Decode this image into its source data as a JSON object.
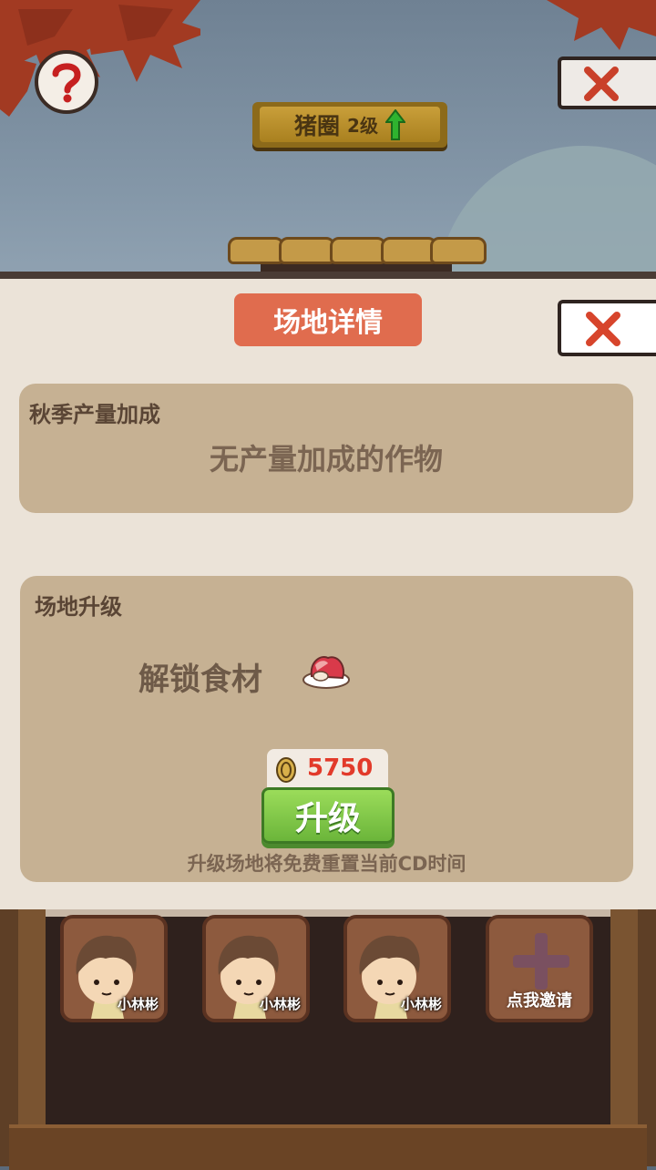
{
  "header": {
    "building_name": "猪圈",
    "level": "2级",
    "help_icon": "question-mark-icon",
    "close_icon": "close-x-icon"
  },
  "panel": {
    "title": "场地详情",
    "season_bonus": {
      "label": "秋季产量加成",
      "text": "无产量加成的作物"
    },
    "upgrade": {
      "label": "场地升级",
      "unlock_text": "解锁食材",
      "unlock_icon": "meat-dish-icon",
      "cost_icon": "coin-icon",
      "cost": "5750",
      "button_label": "升级",
      "note": "升级场地将免费重置当前CD时间"
    }
  },
  "workers": [
    {
      "name": "小林彬",
      "icon": "boy-avatar-icon"
    },
    {
      "name": "小林彬",
      "icon": "boy-avatar-icon"
    },
    {
      "name": "小林彬",
      "icon": "boy-avatar-icon"
    }
  ],
  "invite": {
    "label": "点我邀请",
    "icon": "plus-icon"
  },
  "colors": {
    "title_badge": "#e06c4e",
    "card_bg": "#c6b193",
    "upgrade_button": "#6bb53a",
    "cost_text": "#e23a2a"
  }
}
